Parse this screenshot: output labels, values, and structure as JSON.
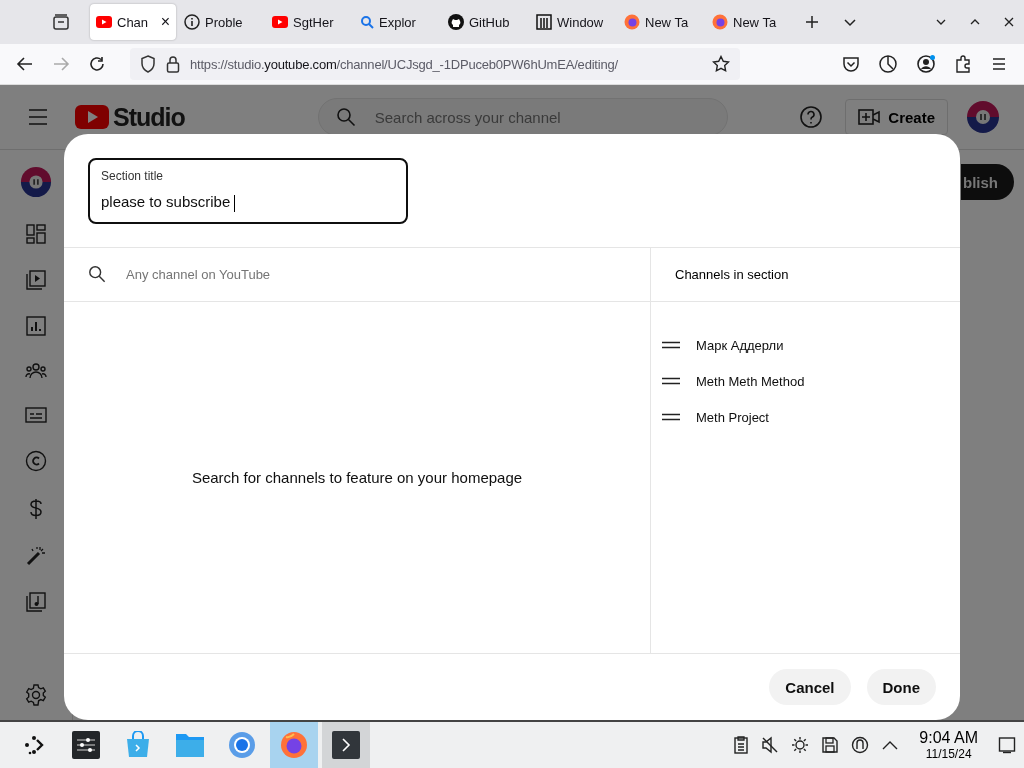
{
  "browser": {
    "tabs": [
      {
        "title": "Chan",
        "kind": "youtube",
        "selected": true,
        "close": "×"
      },
      {
        "title": "Proble",
        "kind": "info",
        "selected": false
      },
      {
        "title": "SgtHer",
        "kind": "youtube",
        "selected": false
      },
      {
        "title": "Explor",
        "kind": "search",
        "selected": false
      },
      {
        "title": "GitHub",
        "kind": "github",
        "selected": false
      },
      {
        "title": "Window",
        "kind": "columns",
        "selected": false
      },
      {
        "title": "New Ta",
        "kind": "firefox",
        "selected": false
      },
      {
        "title": "New Ta",
        "kind": "firefox",
        "selected": false
      }
    ],
    "url": {
      "prefix": "https://studio.",
      "domain": "youtube.com",
      "path": "/channel/UCJsgd_-1DPuceb0PW6hUmEA/editing/"
    }
  },
  "studio": {
    "logo": "Studio",
    "search": {
      "placeholder": "Search across your channel"
    },
    "create": "Create",
    "publish": "blish"
  },
  "dialog": {
    "section_title": {
      "label": "Section title",
      "value": "please to subscribe",
      "focused": true
    },
    "search": {
      "placeholder": "Any channel on YouTube"
    },
    "empty_message": "Search for channels to feature on your homepage",
    "channels_header": "Channels in section",
    "channels": [
      "Марк Аддерли",
      "Meth Meth Method",
      "Meth Project"
    ],
    "buttons": [
      "Cancel",
      "Done"
    ]
  },
  "taskbar": {
    "apps": [
      {
        "kind": "launcher",
        "selected": false,
        "hovered": false
      },
      {
        "kind": "settings",
        "selected": false,
        "hovered": false
      },
      {
        "kind": "store",
        "selected": false,
        "hovered": false
      },
      {
        "kind": "files",
        "selected": false,
        "hovered": false
      },
      {
        "kind": "chromium",
        "selected": false,
        "hovered": false
      },
      {
        "kind": "firefox",
        "selected": true,
        "hovered": false
      },
      {
        "kind": "terminal",
        "selected": false,
        "hovered": true
      }
    ],
    "time": "9:04 AM",
    "date": "11/15/24"
  }
}
